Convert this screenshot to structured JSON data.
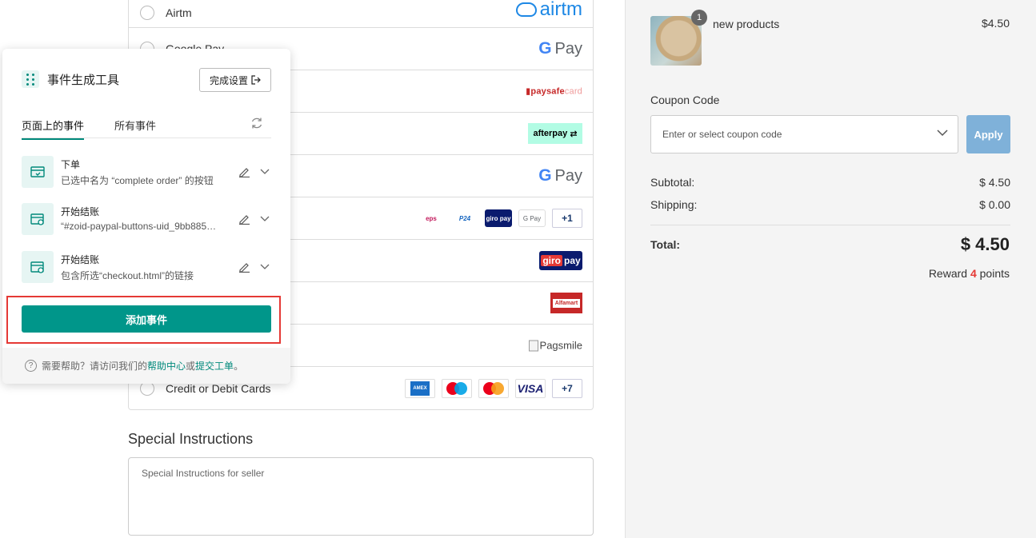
{
  "payments": [
    {
      "name": "Airtm",
      "logo": "airtm"
    },
    {
      "name": "Google Pay",
      "logo": "Pay"
    },
    {
      "name": "",
      "logo": "paysafecard"
    },
    {
      "name": "",
      "logo": "afterpay"
    },
    {
      "name": "",
      "logo": "Pay"
    },
    {
      "name": "",
      "logos": [
        "eps",
        "P24",
        "giropay",
        "G Pay"
      ],
      "more": "+1"
    },
    {
      "name": "",
      "logo": "giropay"
    },
    {
      "name": "",
      "logo": "Alfamart"
    },
    {
      "name": "",
      "logo": "Pagsmile"
    },
    {
      "name": "Credit or Debit Cards",
      "logos": [
        "amex",
        "maestro",
        "mastercard",
        "VISA"
      ],
      "more": "+7"
    }
  ],
  "logo_text": {
    "airtm": "airtm",
    "paysafe_a": "paysafe",
    "paysafe_b": "card",
    "afterpay": "afterpay",
    "pay": "Pay",
    "g": "G",
    "eps": "eps",
    "p24": "P24",
    "giro_small": "giro pay",
    "gpay_small": "G Pay",
    "giro_a": "giro",
    "giro_b": "pay",
    "alfamart": "Alfamart",
    "pagsmile": "Pagsmile",
    "amex": "AMEX",
    "visa": "VISA"
  },
  "special": {
    "title": "Special Instructions",
    "placeholder": "Special Instructions for seller"
  },
  "summary": {
    "product": {
      "name": "new products",
      "price": "$4.50",
      "qty": "1"
    },
    "coupon_label": "Coupon Code",
    "coupon_placeholder": "Enter or select coupon code",
    "apply": "Apply",
    "subtotal_label": "Subtotal:",
    "subtotal": "$ 4.50",
    "shipping_label": "Shipping:",
    "shipping": "$ 0.00",
    "total_label": "Total:",
    "total": "$ 4.50",
    "reward_pre": "Reward ",
    "reward_points": "4",
    "reward_post": " points"
  },
  "panel": {
    "title": "事件生成工具",
    "done_button": "完成设置",
    "tabs": [
      "页面上的事件",
      "所有事件"
    ],
    "events": [
      {
        "title": "下单",
        "desc": "已选中名为 “complete order” 的按钮"
      },
      {
        "title": "开始结账",
        "desc": "“#zoid-paypal-buttons-uid_9bb885…"
      },
      {
        "title": "开始结账",
        "desc": "包含所选“checkout.html”的链接"
      }
    ],
    "add_button": "添加事件",
    "footer_text": "需要帮助？请访问我们的",
    "footer_link1": "帮助中心",
    "footer_or": "或",
    "footer_link2": "提交工单",
    "footer_end": "。"
  },
  "colors": {
    "accent": "#00968a",
    "highlight": "#e53935",
    "apply": "#7fb1d9"
  }
}
